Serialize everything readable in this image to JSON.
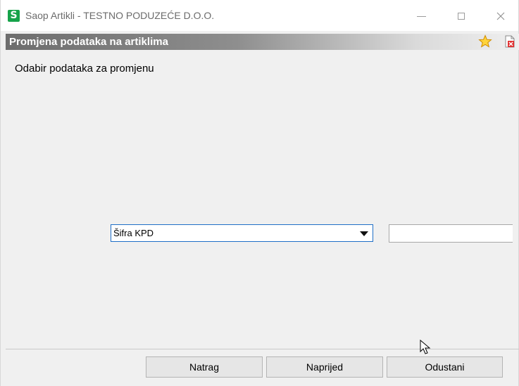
{
  "window": {
    "app_icon_letter": "S",
    "title": "Saop Artikli - TESTNO PODUZEĆE D.O.O."
  },
  "header": {
    "title": "Promjena podataka na artiklima"
  },
  "main": {
    "section_label": "Odabir podataka za promjenu",
    "field_select": {
      "selected": "Šifra KPD"
    },
    "value_input": {
      "value": ""
    }
  },
  "footer": {
    "back_label": "Natrag",
    "next_label": "Naprijed",
    "cancel_label": "Odustani"
  },
  "colors": {
    "app_icon": "#16a34a",
    "combo_focus_border": "#1f6fc7",
    "header_gradient_start": "#6d6d6d"
  },
  "icons": {
    "favorite": "star-icon",
    "close_document": "close-document-icon"
  }
}
